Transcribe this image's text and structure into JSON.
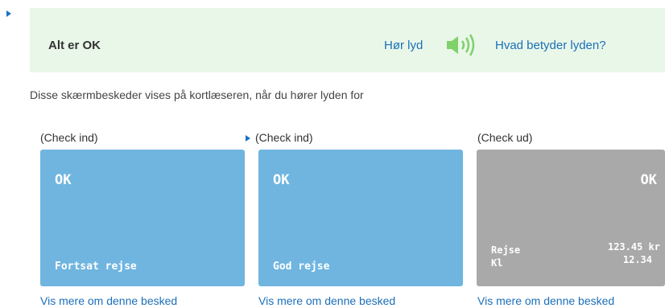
{
  "banner": {
    "title": "Alt er OK",
    "hear_label": "Hør lyd",
    "speaker_icon": "speaker-sound-icon",
    "what_label": "Hvad betyder lyden?",
    "accent_color": "#1c6fb8",
    "background": "#e9f7e9"
  },
  "description": "Disse skærmbeskeder vises på kortlæseren, når du hører lyden for",
  "cards": [
    {
      "label": "(Check ind)",
      "status": "OK",
      "message": "Fortsat rejse",
      "link": "Vis mere om denne besked",
      "color": "#6fb5e0"
    },
    {
      "label": "(Check ind)",
      "status": "OK",
      "message": "God rejse",
      "link": "Vis mere om denne besked",
      "color": "#6fb5e0"
    },
    {
      "label": "(Check ud)",
      "status": "OK",
      "row1_label": "Rejse",
      "row1_value": "123.45 kr",
      "row2_label": "Kl",
      "row2_value": "12.34",
      "link": "Vis mere om denne besked",
      "color": "#a9a9a9"
    }
  ]
}
